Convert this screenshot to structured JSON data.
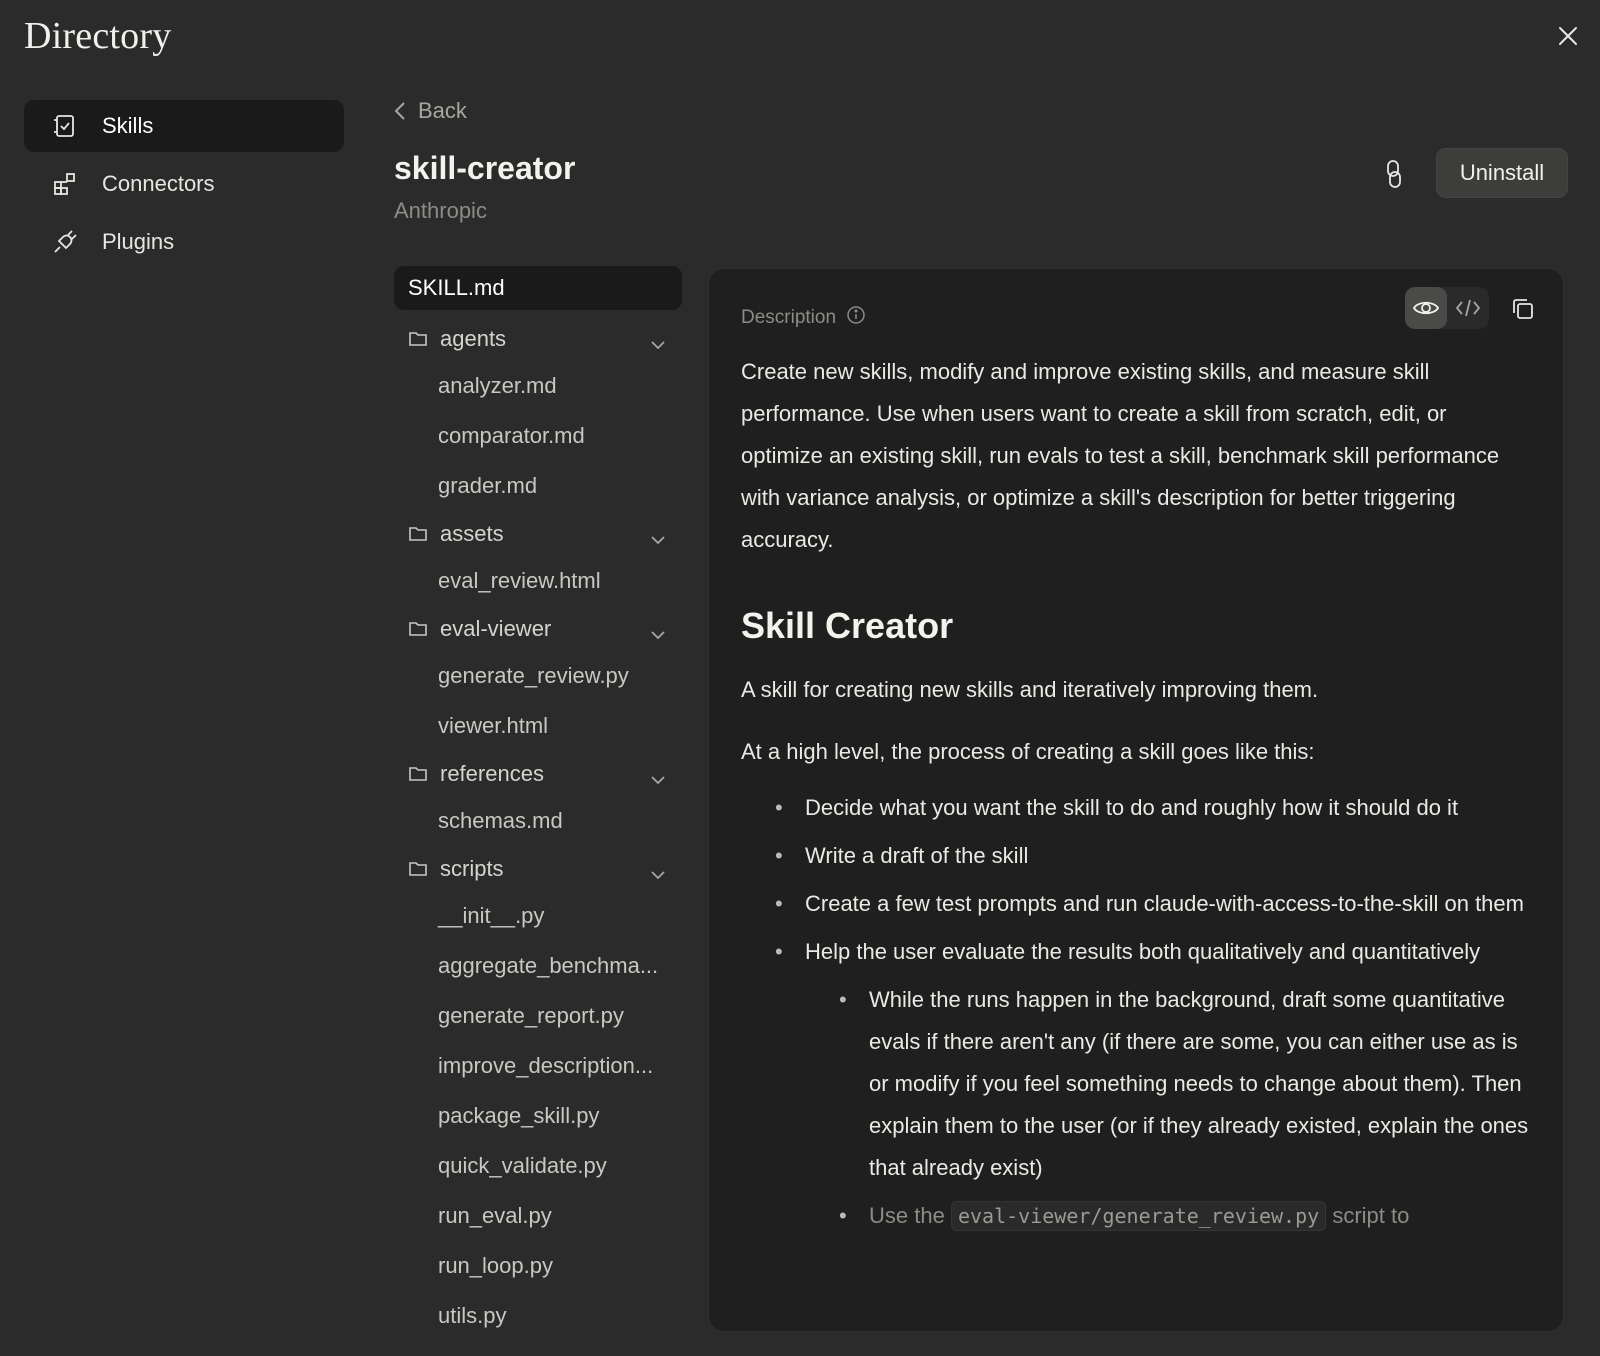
{
  "app": {
    "title": "Directory"
  },
  "nav": {
    "items": [
      {
        "label": "Skills",
        "icon": "scroll-icon",
        "active": true
      },
      {
        "label": "Connectors",
        "icon": "grid-plus-icon",
        "active": false
      },
      {
        "label": "Plugins",
        "icon": "plug-icon",
        "active": false
      }
    ]
  },
  "header": {
    "back_label": "Back",
    "skill_name": "skill-creator",
    "author": "Anthropic",
    "uninstall_label": "Uninstall"
  },
  "tree": {
    "top_file": "SKILL.md",
    "folders": [
      {
        "name": "agents",
        "files": [
          "analyzer.md",
          "comparator.md",
          "grader.md"
        ]
      },
      {
        "name": "assets",
        "files": [
          "eval_review.html"
        ]
      },
      {
        "name": "eval-viewer",
        "files": [
          "generate_review.py",
          "viewer.html"
        ]
      },
      {
        "name": "references",
        "files": [
          "schemas.md"
        ]
      },
      {
        "name": "scripts",
        "files": [
          "__init__.py",
          "aggregate_benchma...",
          "generate_report.py",
          "improve_description...",
          "package_skill.py",
          "quick_validate.py",
          "run_eval.py",
          "run_loop.py",
          "utils.py"
        ]
      }
    ]
  },
  "panel": {
    "description_label": "Description",
    "description": "Create new skills, modify and improve existing skills, and measure skill performance. Use when users want to create a skill from scratch, edit, or optimize an existing skill, run evals to test a skill, benchmark skill performance with variance analysis, or optimize a skill's description for better triggering accuracy.",
    "heading": "Skill Creator",
    "para1": "A skill for creating new skills and iteratively improving them.",
    "para2": "At a high level, the process of creating a skill goes like this:",
    "bullets": [
      "Decide what you want the skill to do and roughly how it should do it",
      "Write a draft of the skill",
      "Create a few test prompts and run claude-with-access-to-the-skill on them",
      "Help the user evaluate the results both qualitatively and quantitatively"
    ],
    "sub_bullet": "While the runs happen in the background, draft some quantitative evals if there aren't any (if there are some, you can either use as is or modify if you feel something needs to change about them). Then explain them to the user (or if they already existed, explain the ones that already exist)",
    "last_bullet_prefix": "Use the",
    "last_bullet_code": "eval-viewer/generate_review.py",
    "last_bullet_suffix": "script to"
  },
  "colors": {
    "background": "#2b2b2b",
    "panel": "#1f1f1f",
    "active": "#1a1a1a",
    "text": "#e8e6e1",
    "muted": "#8d8b86"
  }
}
